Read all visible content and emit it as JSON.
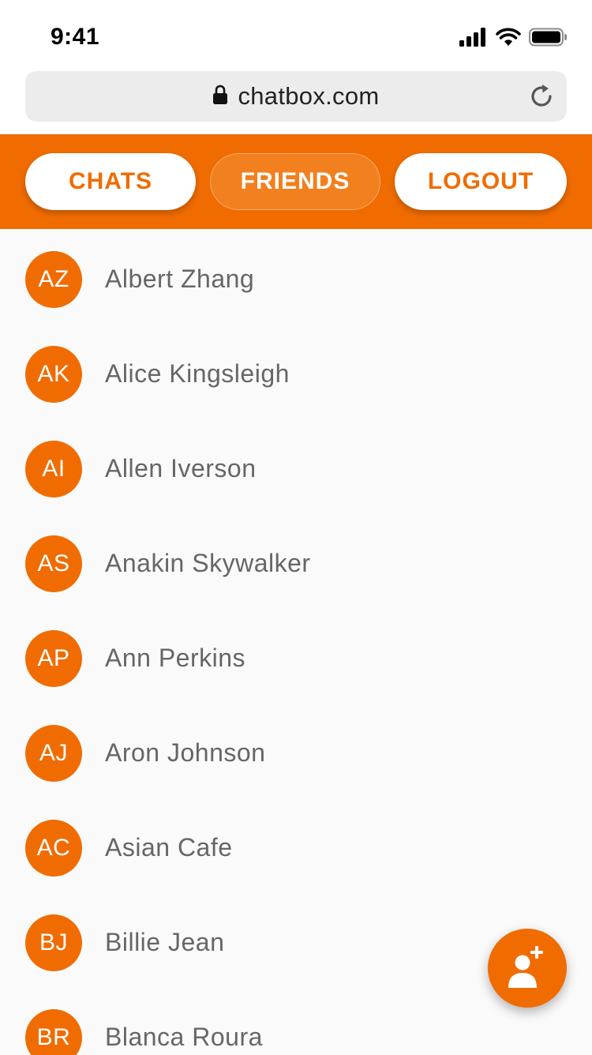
{
  "status_bar": {
    "time": "9:41",
    "icons": [
      "signal-icon",
      "wifi-icon",
      "battery-icon"
    ]
  },
  "browser": {
    "url": "chatbox.com",
    "icons": [
      "lock-icon",
      "reload-icon"
    ]
  },
  "colors": {
    "accent": "#f06c00",
    "background": "#fafafa",
    "name_text": "#666666"
  },
  "nav": {
    "chats_label": "CHATS",
    "friends_label": "FRIENDS",
    "logout_label": "LOGOUT",
    "active_tab": "FRIENDS"
  },
  "friends": [
    {
      "initials": "AZ",
      "name": "Albert Zhang"
    },
    {
      "initials": "AK",
      "name": "Alice Kingsleigh"
    },
    {
      "initials": "AI",
      "name": "Allen Iverson"
    },
    {
      "initials": "AS",
      "name": "Anakin Skywalker"
    },
    {
      "initials": "AP",
      "name": "Ann Perkins"
    },
    {
      "initials": "AJ",
      "name": "Aron Johnson"
    },
    {
      "initials": "AC",
      "name": "Asian Cafe"
    },
    {
      "initials": "BJ",
      "name": "Billie Jean"
    },
    {
      "initials": "BR",
      "name": "Blanca Roura"
    }
  ],
  "fab": {
    "icon": "add-friend-icon"
  }
}
